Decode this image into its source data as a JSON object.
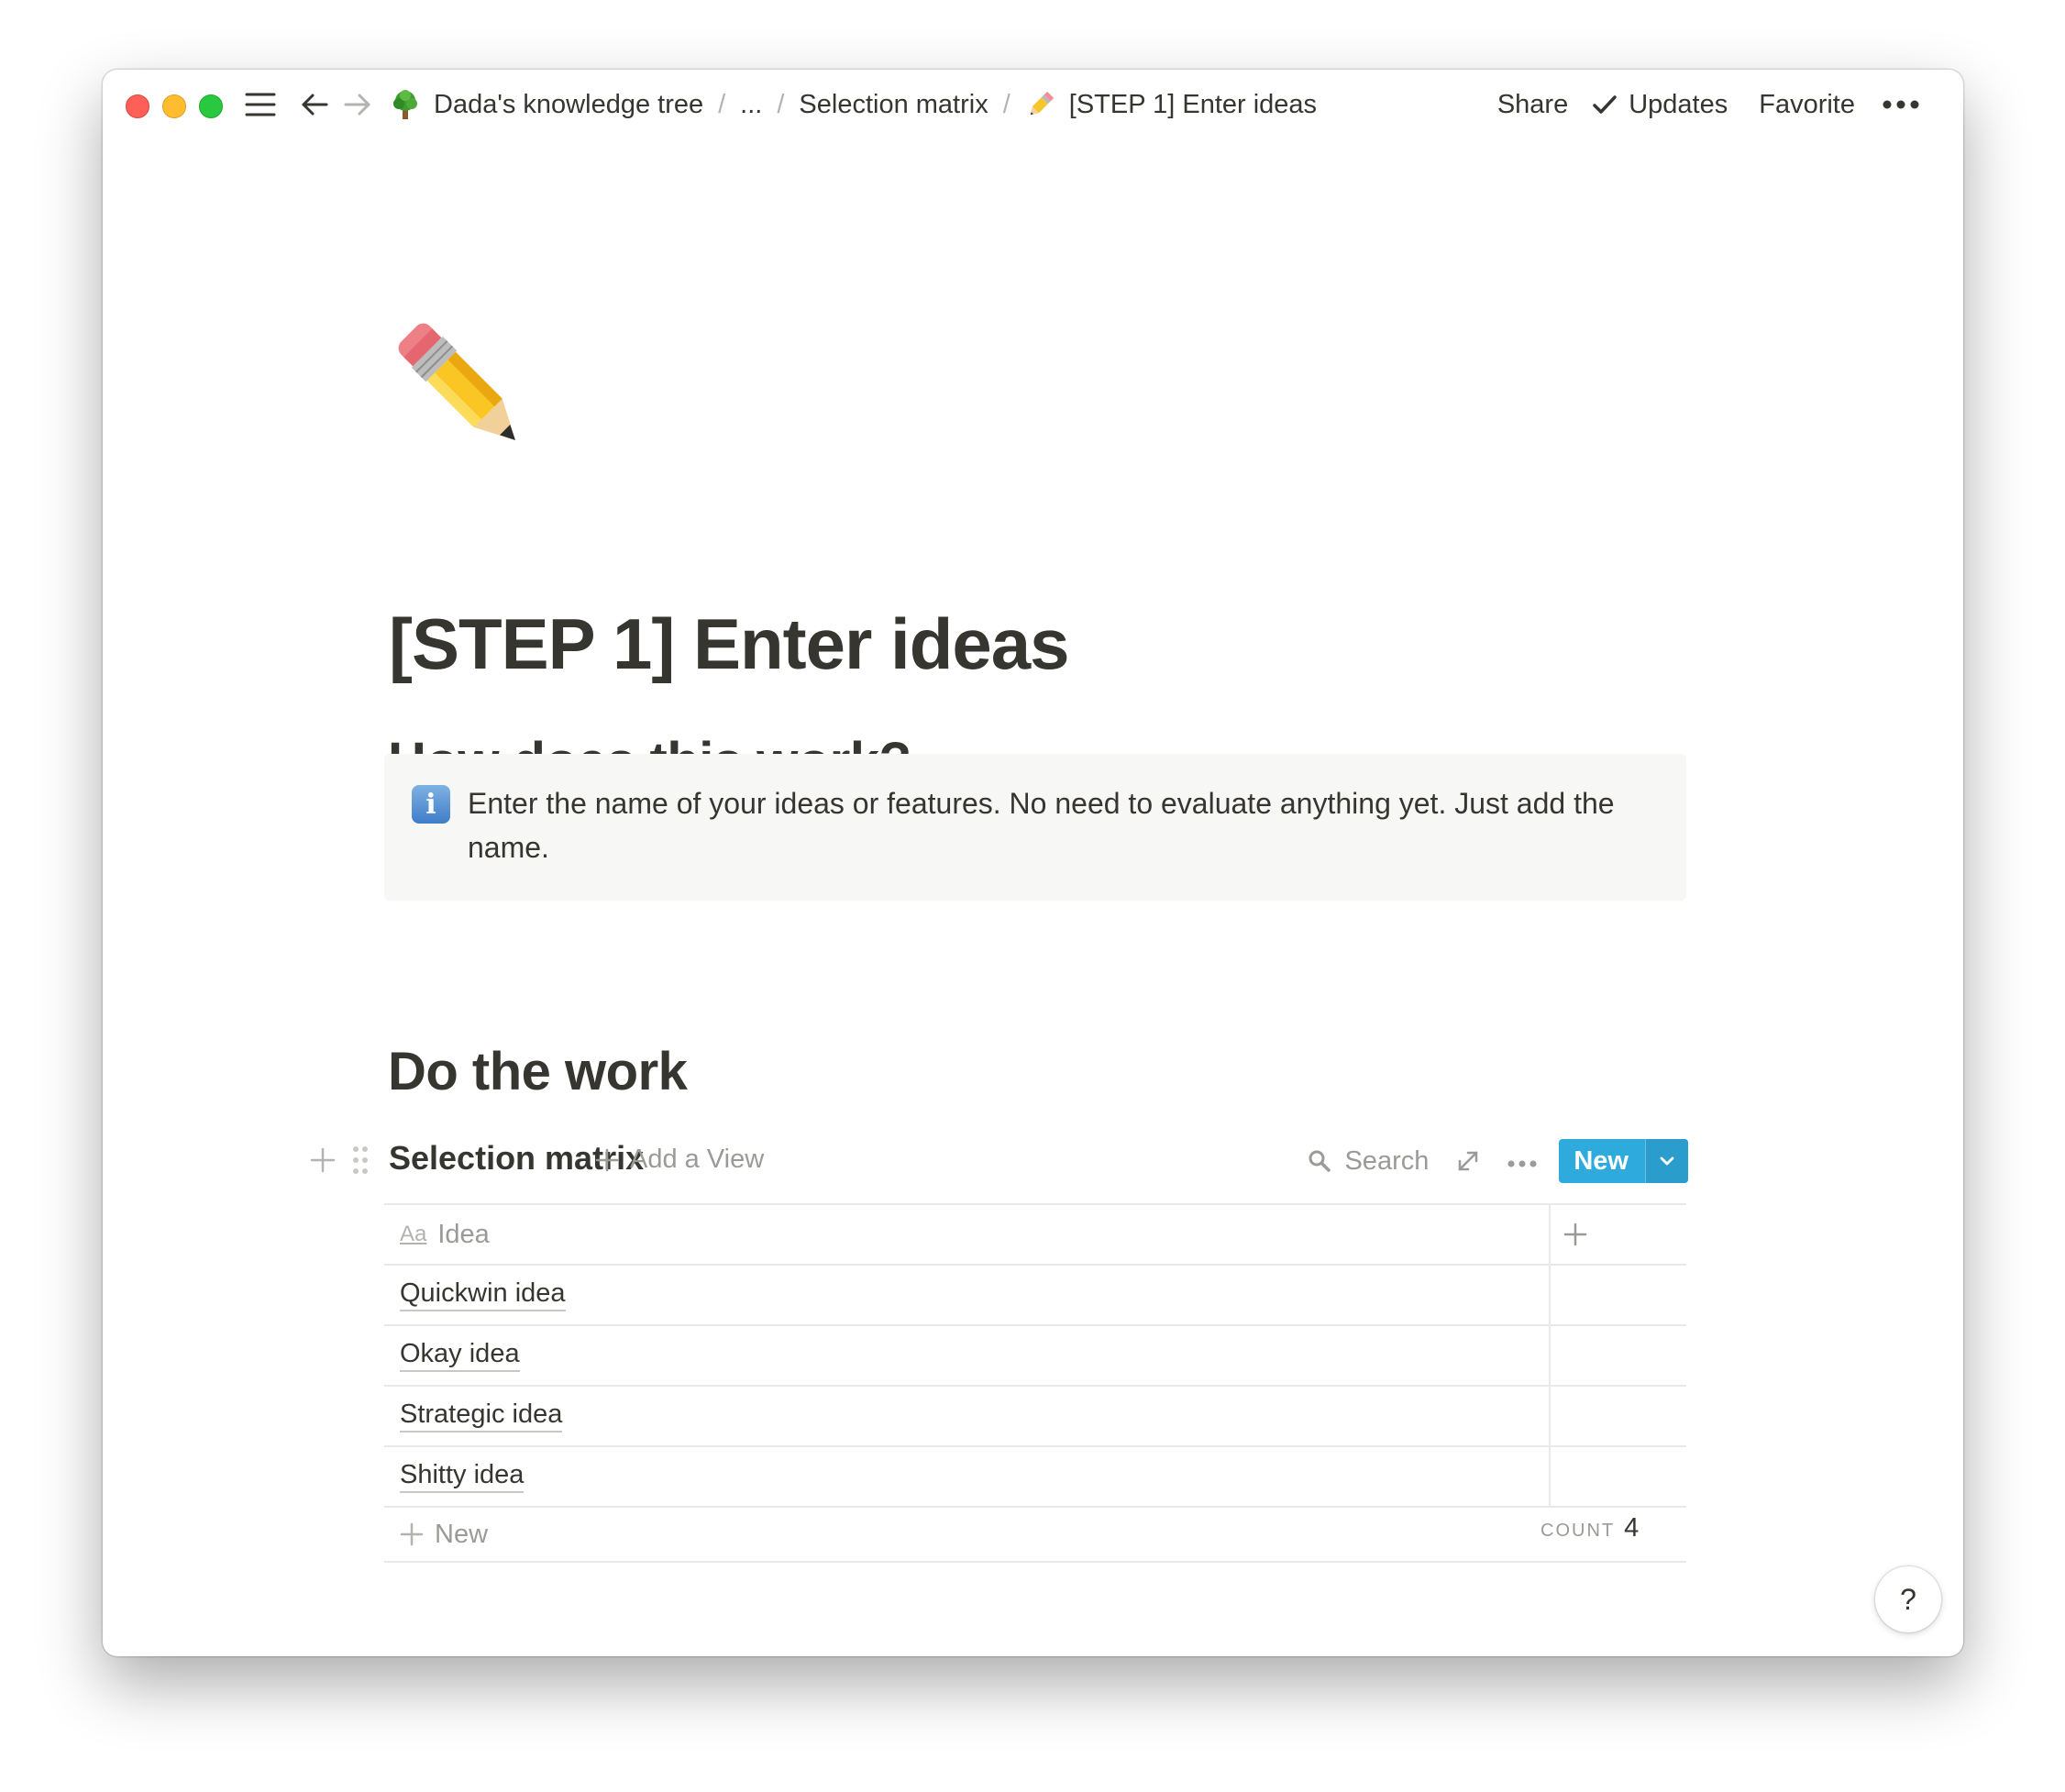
{
  "breadcrumbs": {
    "workspace": "Dada's knowledge tree",
    "ellipsis": "...",
    "parent": "Selection matrix",
    "current": "[STEP 1] Enter ideas",
    "separator": "/"
  },
  "toolbar": {
    "share_label": "Share",
    "updates_label": "Updates",
    "favorite_label": "Favorite"
  },
  "page": {
    "icon": "pencil-emoji",
    "title": "[STEP 1] Enter ideas"
  },
  "sections": {
    "how_heading": "How does this work?",
    "callout_icon": "information-icon",
    "callout_text": "Enter the name of your ideas or features. No need to evaluate anything yet. Just add the name.",
    "work_heading": "Do the work"
  },
  "database": {
    "title": "Selection matrix",
    "add_view_label": "Add a View",
    "search_label": "Search",
    "new_label": "New",
    "column_header": "Idea",
    "column_type_icon": "Aa",
    "rows": [
      "Quickwin idea",
      "Okay idea",
      "Strategic idea",
      "Shitty idea"
    ],
    "new_row_label": "New",
    "count_label": "COUNT",
    "count_value": "4"
  },
  "help": {
    "label": "?"
  },
  "colors": {
    "accent_button": "#2eaadc",
    "text": "#37352f",
    "muted_text": "#9b9a97",
    "callout_bg": "#f7f7f5"
  }
}
